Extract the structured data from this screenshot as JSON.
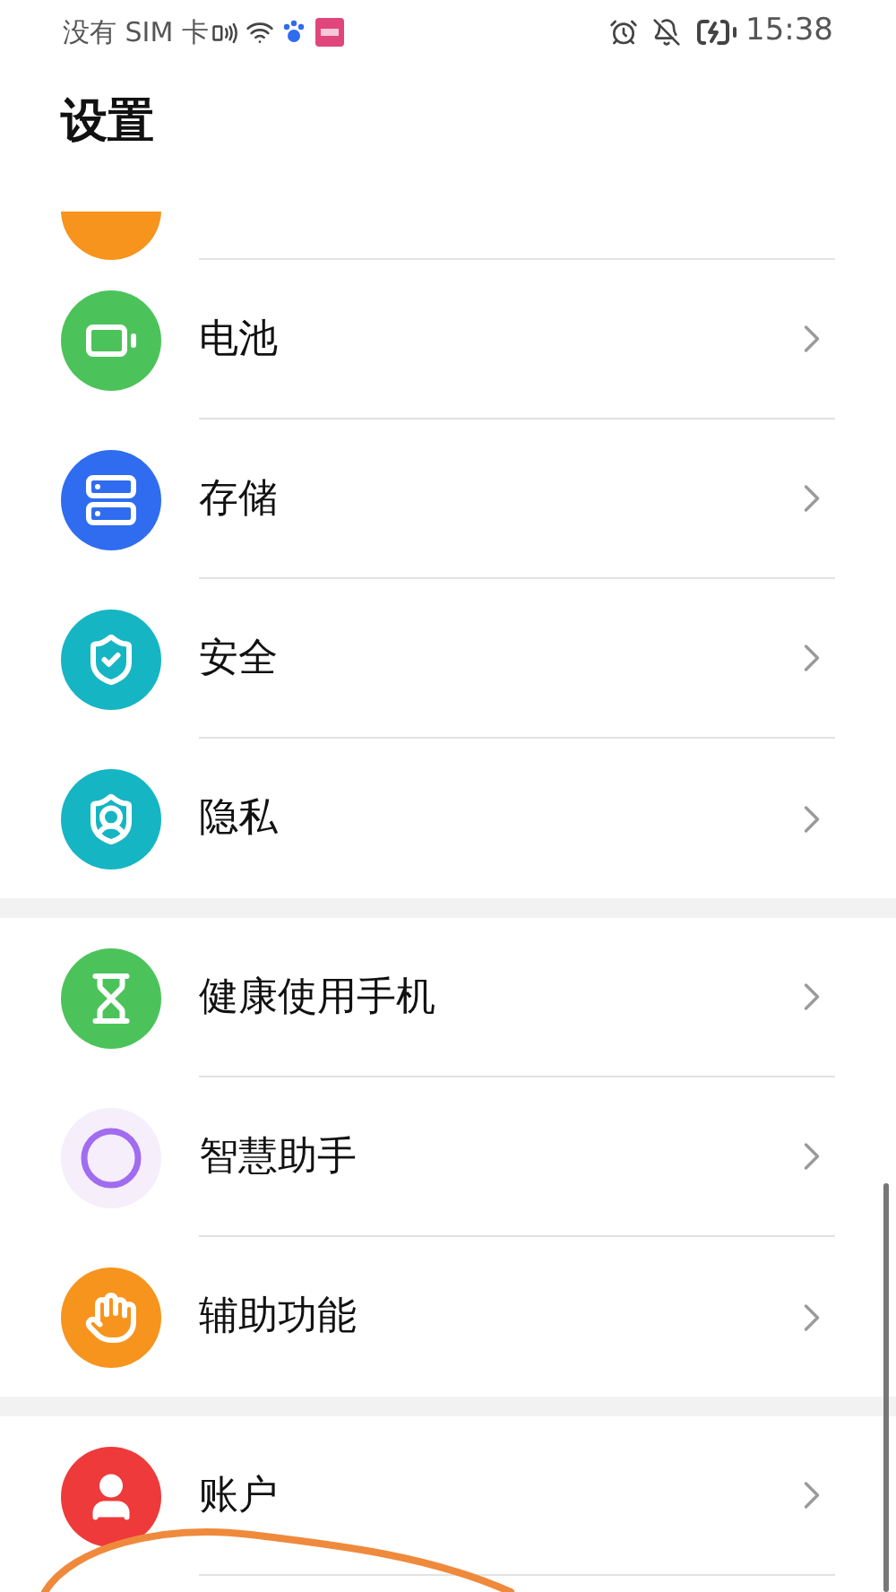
{
  "status_bar": {
    "carrier": "没有 SIM 卡",
    "time": "15:38"
  },
  "title": "设置",
  "groups": [
    {
      "items": [
        {
          "label": "电池",
          "kind": "battery",
          "color": "#4cc35a"
        },
        {
          "label": "存储",
          "kind": "storage",
          "color": "#2f6cf0"
        },
        {
          "label": "安全",
          "kind": "security",
          "color": "#16b5c4"
        },
        {
          "label": "隐私",
          "kind": "privacy",
          "color": "#16b5c4"
        }
      ]
    },
    {
      "items": [
        {
          "label": "健康使用手机",
          "kind": "health",
          "color": "#4cc35a"
        },
        {
          "label": "智慧助手",
          "kind": "assistant",
          "color": "#a06cf0"
        },
        {
          "label": "辅助功能",
          "kind": "accessibility",
          "color": "#f7941d"
        }
      ]
    },
    {
      "items": [
        {
          "label": "账户",
          "kind": "account",
          "color": "#ee3a3a"
        }
      ]
    }
  ]
}
